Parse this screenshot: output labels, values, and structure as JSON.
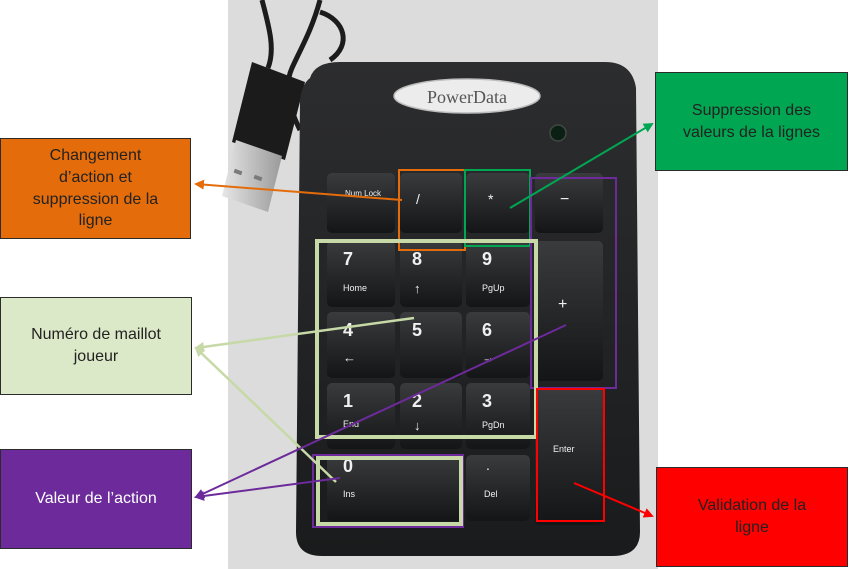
{
  "brand": "PowerData",
  "keys": {
    "numlock": "Num Lock",
    "slash": "/",
    "star": "*",
    "minus": "−",
    "k7": "7",
    "k7_sub": "Home",
    "k8": "8",
    "k8_sub": "↑",
    "k9": "9",
    "k9_sub": "PgUp",
    "plus": "+",
    "k4": "4",
    "k4_sub": "←",
    "k5": "5",
    "k6": "6",
    "k6_sub": "→",
    "k1": "1",
    "k1_sub": "End",
    "k2": "2",
    "k2_sub": "↓",
    "k3": "3",
    "k3_sub": "PgDn",
    "enter": "Enter",
    "k0": "0",
    "k0_sub": "Ins",
    "dot": ".",
    "dot_sub": "Del"
  },
  "callouts": {
    "change": "Changement\nd’action et\nsuppression de la\nligne",
    "delete": "Suppression  des\nvaleurs de la lignes",
    "player": "Numéro de maillot\njoueur",
    "value": "Valeur de l’action",
    "validation": "Validation de la\nligne"
  },
  "colors": {
    "orange": "#e46c0a",
    "green": "#00a651",
    "light_green": "#c6d9a6",
    "purple": "#6c2a9a",
    "red": "#ff0000"
  }
}
